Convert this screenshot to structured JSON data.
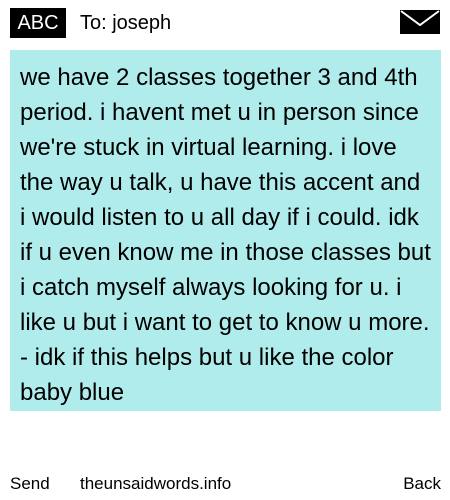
{
  "header": {
    "mode": "ABC",
    "recipient": "To: joseph",
    "envelope_icon": "envelope-icon"
  },
  "message": {
    "text": "we have 2 classes together 3 and 4th period. i havent met u in person since we're stuck in virtual learning. i love the way u talk, u have this accent and i would listen to u all day if i could. idk if u even know me in those classes but i catch myself always looking for u. i like u but i want to get to know u more. - idk if this helps but u like the color baby blue",
    "background_color": "#b1ecec"
  },
  "footer": {
    "send_label": "Send",
    "site": "theunsaidwords.info",
    "back_label": "Back"
  }
}
